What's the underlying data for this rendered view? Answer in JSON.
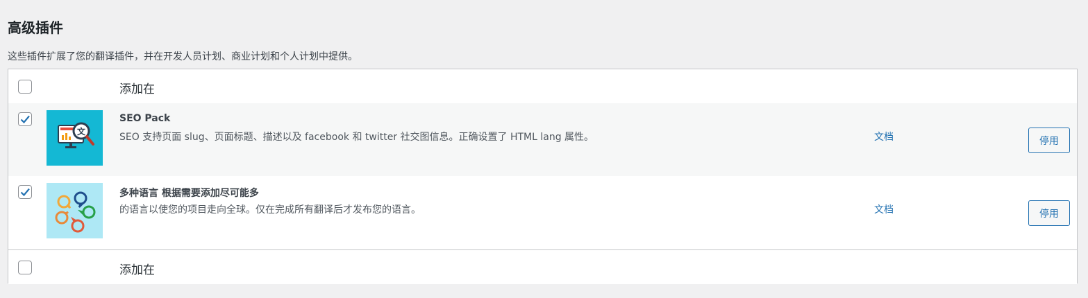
{
  "section": {
    "title": "高级插件",
    "description": "这些插件扩展了您的翻译插件，并在开发人员计划、商业计划和个人计划中提供。"
  },
  "table": {
    "header_label": "添加在",
    "footer_label": "添加在",
    "plugins": [
      {
        "title": "SEO Pack",
        "description": "SEO 支持页面 slug、页面标题、描述以及 facebook 和 twitter 社交图信息。正确设置了 HTML lang 属性。",
        "doc_label": "文档",
        "action_label": "停用",
        "checked": true,
        "icon": "seo-magnifier-icon"
      },
      {
        "title": "多种语言 根据需要添加尽可能多",
        "description": "的语言以使您的项目走向全球。仅在完成所有翻译后才发布您的语言。",
        "doc_label": "文档",
        "action_label": "停用",
        "checked": true,
        "icon": "speech-bubbles-icon"
      }
    ]
  },
  "colors": {
    "accent": "#2271b1",
    "page_bg": "#f0f0f1",
    "border": "#c3c4c7",
    "seo_thumb_bg": "#14b8d4",
    "multilang_thumb_bg": "#aee8f5"
  }
}
